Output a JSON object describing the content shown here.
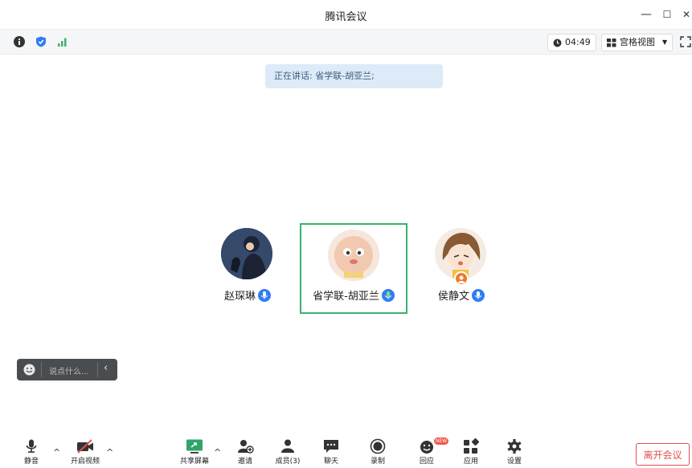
{
  "window": {
    "title": "腾讯会议",
    "minimize": "—",
    "maximize": "☐",
    "close": "✕"
  },
  "infobar": {
    "timer": "04:49",
    "view_label": "宫格视图",
    "icons": [
      "info-icon",
      "shield-icon",
      "signal-icon"
    ]
  },
  "speaking": {
    "text": "正在讲话: 省学联-胡亚兰;"
  },
  "participants": [
    {
      "name": "赵琛琳",
      "mic": "unmuted",
      "active": false
    },
    {
      "name": "省学联-胡亚兰",
      "mic": "speaking",
      "active": true
    },
    {
      "name": "侯静文",
      "mic": "unmuted",
      "active": false
    }
  ],
  "chat": {
    "placeholder": "说点什么..."
  },
  "toolbar": {
    "mute": "静音",
    "video": "开启视频",
    "share": "共享屏幕",
    "invite": "邀请",
    "members": "成员(3)",
    "chat": "聊天",
    "record": "录制",
    "react": "回应",
    "apps": "应用",
    "settings": "设置",
    "new_badge": "NEW",
    "leave": "离开会议"
  },
  "colors": {
    "accent_blue": "#2f7df6",
    "active_border": "#38b36b",
    "leave_red": "#e6504d"
  }
}
